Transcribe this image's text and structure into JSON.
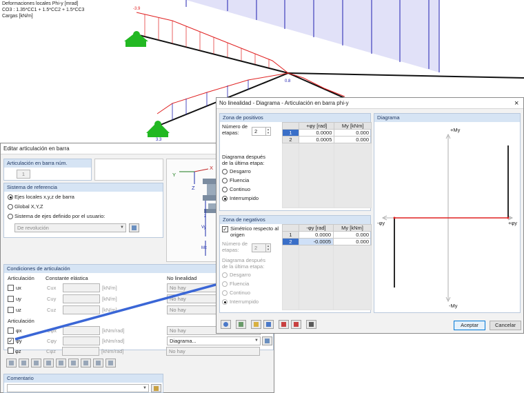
{
  "model": {
    "info_lines": [
      "Deformaciones locales Phi-y [mrad]",
      "CO3 : 1.35*CC1 + 1.5*CC2 + 1.5*CC3",
      "Cargas [kN/m]"
    ],
    "value_labels": [
      "-3.9",
      "0.8",
      "3.3"
    ]
  },
  "editor": {
    "title": "Editar articulación en barra",
    "articulation_header": "Articulación en barra núm.",
    "articulation_no": "1",
    "ref_system_header": "Sistema de referencia",
    "ref_options": [
      "Ejes locales x,y,z de barra",
      "Global X,Y,Z",
      "Sistema de ejes definido por el usuario:"
    ],
    "ref_dropdown": "De revolución",
    "conditions_header": "Condiciones de articulación",
    "col_articulacion": "Articulación",
    "col_constante": "Constante elástica",
    "col_nolinealidad": "No linealidad",
    "translation_rows": [
      {
        "name": "ux",
        "constant": "Cux",
        "unit": "[kN/m]",
        "nonlin": "No hay"
      },
      {
        "name": "uy",
        "constant": "Cuy",
        "unit": "[kN/m]",
        "nonlin": "No hay"
      },
      {
        "name": "uz",
        "constant": "Cuz",
        "unit": "[kN/m]",
        "nonlin": "No hay"
      }
    ],
    "rotation_label": "Articulación",
    "rotation_rows": [
      {
        "name": "φx",
        "constant": "Cφx",
        "unit": "[kNm/rad]",
        "nonlin": "No hay",
        "checked": false
      },
      {
        "name": "φy",
        "constant": "Cφy",
        "unit": "[kNm/rad]",
        "nonlin": "Diagrama...",
        "checked": true
      },
      {
        "name": "φz",
        "constant": "Cφz",
        "unit": "[kNm/rad]",
        "nonlin": "No hay",
        "checked": false
      }
    ],
    "comment_header": "Comentario",
    "axis_labels": {
      "Y": "Y",
      "X": "X",
      "Z": "Z",
      "z": "z",
      "vy": "Vy",
      "mz": "Mz"
    }
  },
  "dialog": {
    "title": "No linealidad - Diagrama - Articulación en barra phi-y",
    "close_symbol": "×",
    "positive": {
      "header": "Zona de positivos",
      "steps_label": [
        "Número de",
        "etapas:"
      ],
      "steps": "2",
      "after_label": [
        "Diagrama después",
        "de la última etapa:"
      ],
      "options": [
        "Desgarro",
        "Fluencia",
        "Continuo",
        "Interrumpido"
      ],
      "selected": 3,
      "col_phi": "+φy [rad]",
      "col_m": "My [kNm]",
      "rows": [
        {
          "no": "1",
          "phi": "0.0000",
          "m": "0.000"
        },
        {
          "no": "2",
          "phi": "0.0005",
          "m": "0.000"
        }
      ]
    },
    "negative": {
      "header": "Zona de negativos",
      "symmetric_label": [
        "Simétrico respecto al",
        "origen"
      ],
      "steps_label": [
        "Número de",
        "etapas:"
      ],
      "steps": "2",
      "after_label": [
        "Diagrama después",
        "de la última etapa:"
      ],
      "options": [
        "Desgarro",
        "Fluencia",
        "Continuo",
        "Interrumpido"
      ],
      "selected": 3,
      "col_phi": "-φy [rad]",
      "col_m": "My [kNm]",
      "rows": [
        {
          "no": "1",
          "phi": "0.0000",
          "m": "0.000"
        },
        {
          "no": "2",
          "phi": "-0.0005",
          "m": "0.000"
        }
      ]
    },
    "diagram": {
      "header": "Diagrama",
      "plus_m": "+My",
      "minus_m": "-My",
      "plus_phi": "+φy",
      "minus_phi": "-φy"
    },
    "accept": "Aceptar",
    "cancel": "Cancelar"
  },
  "colors": {
    "accent": "#0078d7",
    "group_header": "#d6e4f4",
    "load_fill": "#c9c9f2",
    "load_line": "#2020b0",
    "deform_red": "#e02020",
    "support_green": "#22b822",
    "callout_arrow": "#3a66d6",
    "diagram_red": "#e02020"
  }
}
